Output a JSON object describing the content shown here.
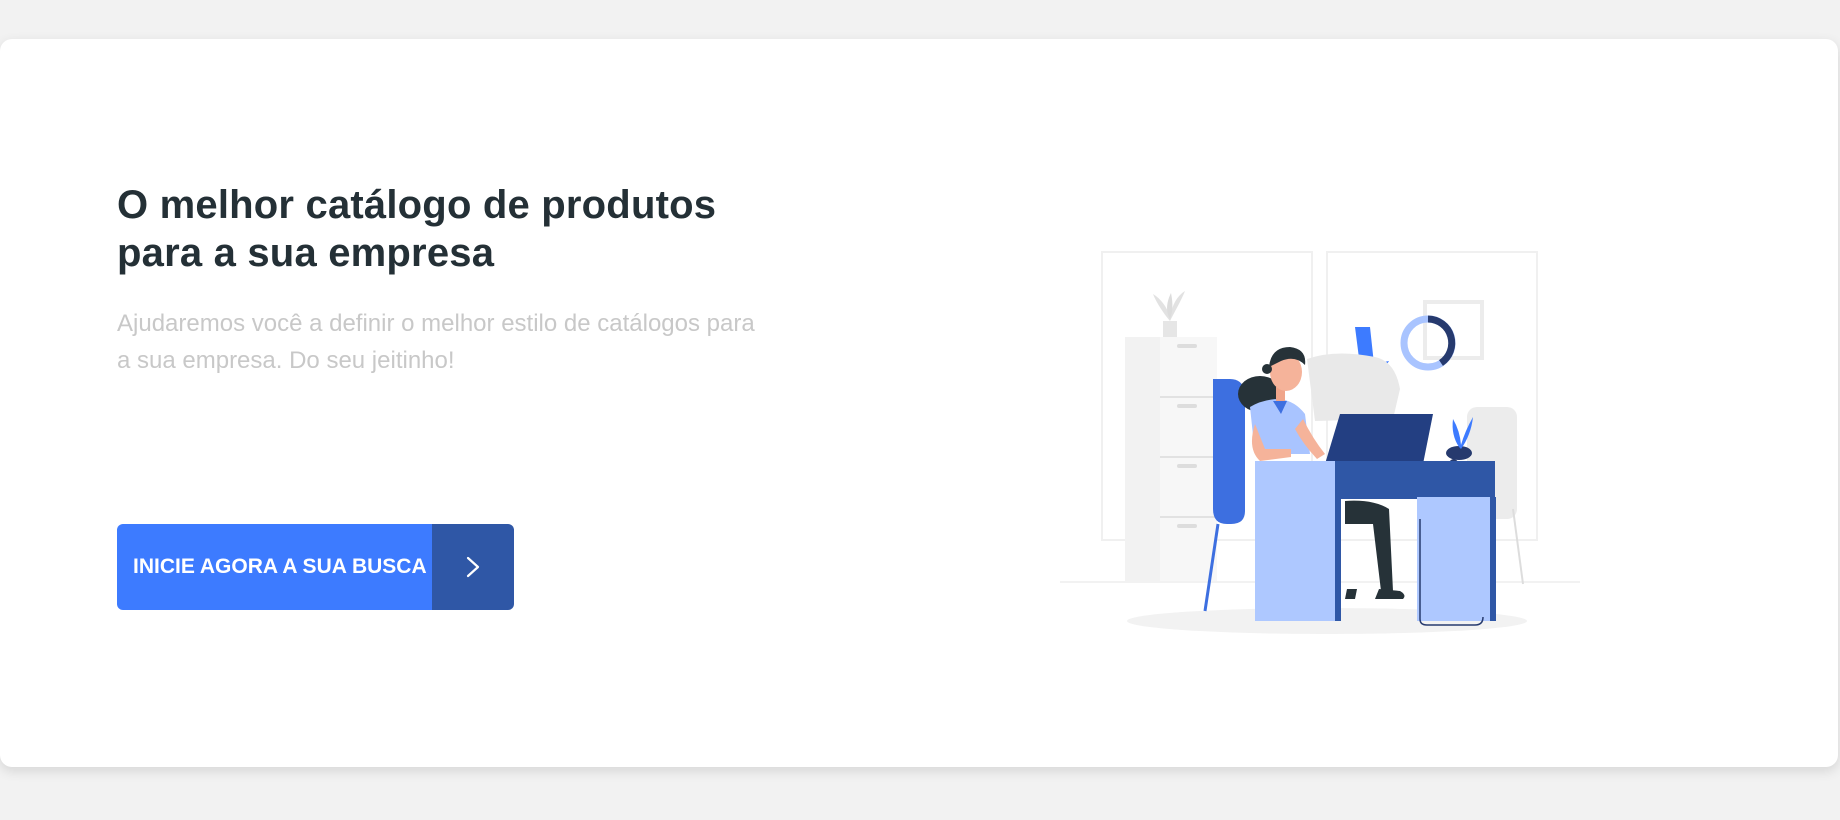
{
  "hero": {
    "title_line1": "O melhor catálogo de produtos",
    "title_line2": "para a sua empresa",
    "subtitle_line1": "Ajudaremos você a definir o melhor estilo de catálogos para",
    "subtitle_line2": "a sua empresa. Do seu jeitinho!",
    "cta_label": "INICIE AGORA A SUA BUSCA",
    "cta_icon": "chevron-right-icon"
  },
  "colors": {
    "accent": "#3d7bff",
    "accent_dark": "#2f57a6",
    "title": "#243036",
    "subtitle": "#c8c8c8"
  }
}
